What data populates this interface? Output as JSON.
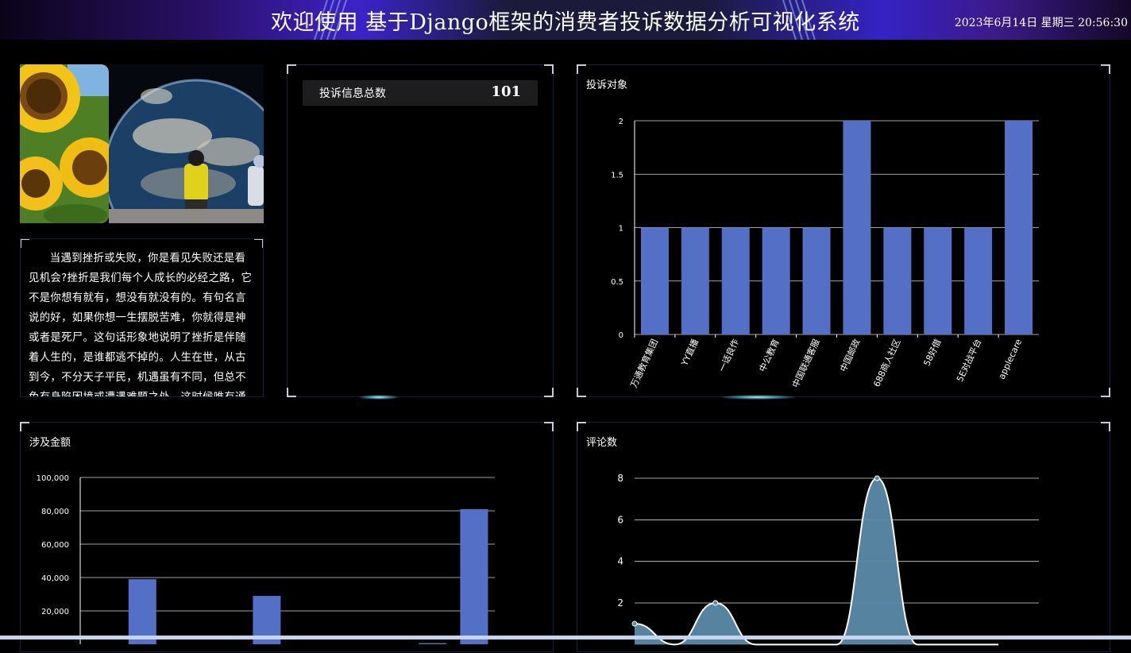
{
  "header": {
    "title": "欢迎使用 基于Django框架的消费者投诉数据分析可视化系统",
    "datetime": "2023年6月14日 星期三 20:56:30"
  },
  "intro_text": "当遇到挫折或失败，你是看见失败还是看见机会?挫折是我们每个人成长的必经之路，它不是你想有就有，想没有就没有的。有句名言说的好，如果你想一生摆脱苦难，你就得是神或者是死尸。这句话形象地说明了挫折是伴随着人生的，是谁都逃不掉的。人生在世，从古到今，不分天子平民，机遇虽有不同，但总不免有身陷困境或遭遇难题之处，这时候唯有通",
  "total": {
    "label": "投诉信息总数",
    "value": "101"
  },
  "panels": {
    "complaint_target": {
      "title": "投诉对象"
    },
    "amount": {
      "title": "涉及金额"
    },
    "comments": {
      "title": "评论数"
    }
  },
  "colors": {
    "bar": "#5470c6",
    "area_fill": "#5b8aa8",
    "line": "#ffffff",
    "grid": "#ffffff",
    "header_accent": "#3b23c8"
  },
  "chart_data": [
    {
      "id": "complaint_target",
      "type": "bar",
      "title": "投诉对象",
      "categories": [
        "万通教育集团",
        "YY直播",
        "一话良作",
        "中公教育",
        "中国联通客服",
        "中国邮政",
        "688商人社区",
        "58好借",
        "5E对战平台",
        "applecare"
      ],
      "values": [
        1,
        1,
        1,
        1,
        1,
        2,
        1,
        1,
        1,
        2
      ],
      "yticks": [
        "0",
        "0.5",
        "1",
        "1.5",
        "2"
      ],
      "ylim": [
        0,
        2
      ],
      "grid": true
    },
    {
      "id": "amount",
      "type": "bar",
      "title": "涉及金额",
      "values": [
        0,
        39000,
        0,
        0,
        29000,
        0,
        0,
        0,
        700,
        81000
      ],
      "yticks": [
        "20,000",
        "40,000",
        "60,000",
        "80,000",
        "100,000"
      ],
      "ylim": [
        0,
        100000
      ],
      "grid": true
    },
    {
      "id": "comments",
      "type": "area",
      "title": "评论数",
      "values": [
        1,
        0,
        2,
        0,
        0,
        0,
        8,
        0,
        0,
        0
      ],
      "yticks": [
        "2",
        "4",
        "6",
        "8"
      ],
      "ylim": [
        0,
        8
      ],
      "grid": true
    }
  ]
}
